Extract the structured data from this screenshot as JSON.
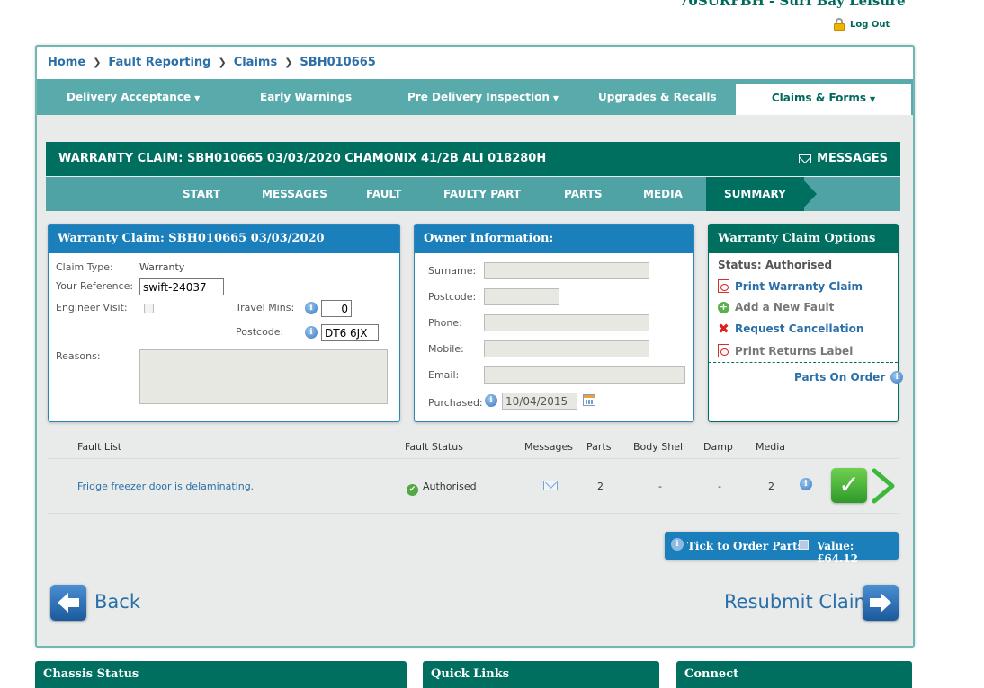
{
  "header": {
    "dealer_title": "70SURFBH - Surf Bay Leisure",
    "logout_label": "Log Out"
  },
  "breadcrumb": [
    "Home",
    "Fault Reporting",
    "Claims",
    "SBH010665"
  ],
  "main_nav": [
    {
      "label": "Delivery Acceptance",
      "dropdown": true
    },
    {
      "label": "Early Warnings",
      "dropdown": false
    },
    {
      "label": "Pre Delivery Inspection",
      "dropdown": true
    },
    {
      "label": "Upgrades & Recalls",
      "dropdown": false
    },
    {
      "label": "Claims & Forms",
      "dropdown": true,
      "active": true
    }
  ],
  "claim_header": {
    "title": "WARRANTY CLAIM: SBH010665 03/03/2020 CHAMONIX 41/2B ALI 018280H",
    "messages_label": "MESSAGES"
  },
  "steps": [
    "START",
    "MESSAGES",
    "FAULT",
    "FAULTY PART",
    "PARTS",
    "MEDIA",
    "SUMMARY"
  ],
  "claim_panel": {
    "title": "Warranty Claim: SBH010665 03/03/2020",
    "claim_type_label": "Claim Type:",
    "claim_type_value": "Warranty",
    "reference_label": "Your Reference:",
    "reference_value": "swift-24037",
    "engineer_visit_label": "Engineer Visit:",
    "travel_mins_label": "Travel Mins:",
    "travel_mins_value": "0",
    "postcode_label": "Postcode:",
    "postcode_value": "DT6 6JX",
    "reasons_label": "Reasons:",
    "reasons_value": ""
  },
  "owner_panel": {
    "title": "Owner Information:",
    "surname_label": "Surname:",
    "postcode_label": "Postcode:",
    "phone_label": "Phone:",
    "mobile_label": "Mobile:",
    "email_label": "Email:",
    "purchased_label": "Purchased:",
    "purchased_value": "10/04/2015"
  },
  "options_panel": {
    "title": "Warranty Claim Options",
    "status": "Status: Authorised",
    "print_claim": "Print Warranty Claim",
    "add_fault": "Add a New Fault",
    "request_cancel": "Request Cancellation",
    "print_returns": "Print Returns Label",
    "parts_on_order": "Parts On Order"
  },
  "fault_table": {
    "headers": [
      "Fault List",
      "Fault Status",
      "Messages",
      "Parts",
      "Body Shell",
      "Damp",
      "Media"
    ],
    "rows": [
      {
        "fault": "Fridge freezer door is delaminating.",
        "status": "Authorised",
        "parts": "2",
        "body_shell": "-",
        "damp": "-",
        "media": "2"
      }
    ]
  },
  "order_bar": {
    "tick_label": "Tick to Order Parts:",
    "value_label": "Value: £64.12"
  },
  "buttons": {
    "back": "Back",
    "resubmit": "Resubmit Claim"
  },
  "footer": [
    "Chassis Status",
    "Quick Links",
    "Connect"
  ],
  "colors": {
    "brand_green": "#006f60",
    "nav_teal": "#59aaaa",
    "panel_blue": "#1a7fba",
    "link_blue": "#2a6fa8"
  }
}
